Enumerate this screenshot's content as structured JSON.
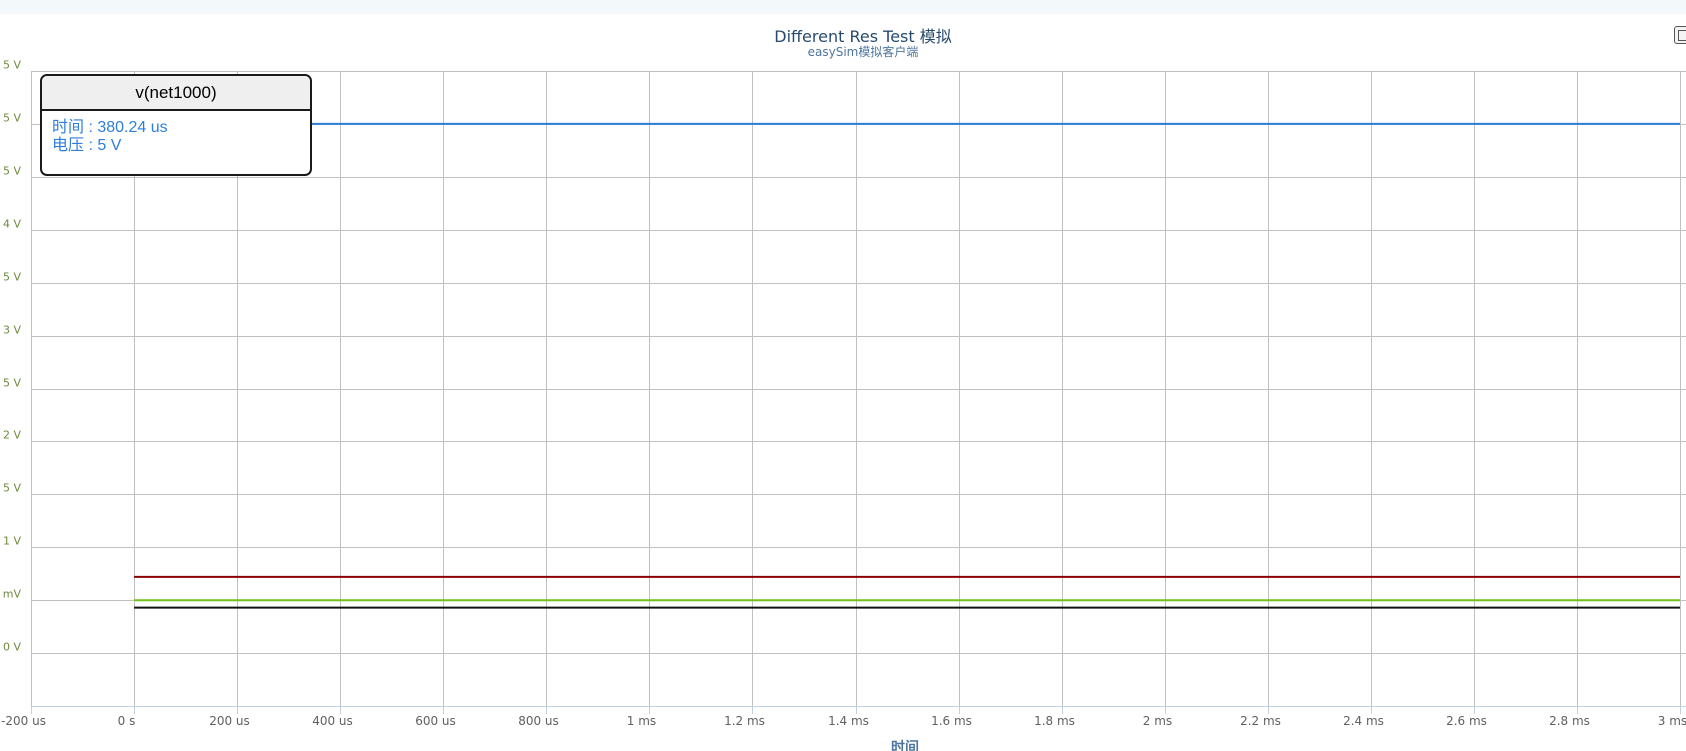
{
  "chart": {
    "title": "Different Res Test 模拟",
    "subtitle": "easySim模拟客户端",
    "xlabel": "时间"
  },
  "tooltip": {
    "series": "v(net1000)",
    "time_label": "时间",
    "time_value": "380.24 us",
    "voltage_label": "电压",
    "voltage_value": "5 V",
    "color": "#2f7ed8"
  },
  "export_button": {
    "icon": "context-menu-icon"
  },
  "chart_data": {
    "type": "line",
    "title": "Different Res Test 模拟",
    "subtitle": "easySim模拟客户端",
    "xlabel": "时间",
    "xunit": "us",
    "xlim": [
      -200,
      3000
    ],
    "ylim": [
      -0.5,
      5.5
    ],
    "grid": true,
    "x_tick_values": [
      -200,
      0,
      200,
      400,
      600,
      800,
      1000,
      1200,
      1400,
      1600,
      1800,
      2000,
      2200,
      2400,
      2600,
      2800,
      3000
    ],
    "x_tick_labels": [
      "-200 us",
      "0 s",
      "200 us",
      "400 us",
      "600 us",
      "800 us",
      "1 ms",
      "1.2 ms",
      "1.4 ms",
      "1.6 ms",
      "1.8 ms",
      "2 ms",
      "2.2 ms",
      "2.4 ms",
      "2.6 ms",
      "2.8 ms",
      "3 ms"
    ],
    "y_tick_values": [
      -0.5,
      0,
      0.5,
      1,
      1.5,
      2,
      2.5,
      3,
      3.5,
      4,
      4.5,
      5,
      5.5
    ],
    "y_tick_labels": [
      "",
      "0 V",
      "mV",
      "1 V",
      "5 V",
      "2 V",
      "5 V",
      "3 V",
      "5 V",
      "4 V",
      "5 V",
      "5 V",
      "5 V"
    ],
    "y_tick_color": "#6d8a3c",
    "series": [
      {
        "name": "v(net1000)",
        "color": "#2f7ed8",
        "x": [
          0,
          3000
        ],
        "y": [
          5,
          5
        ],
        "extends_left": true
      },
      {
        "color": "#8b0000",
        "x": [
          0,
          3000
        ],
        "y": [
          0.72,
          0.72
        ]
      },
      {
        "color": "#6fc21c",
        "x": [
          0,
          3000
        ],
        "y": [
          0.5,
          0.5
        ]
      },
      {
        "color": "#111111",
        "x": [
          0,
          3000
        ],
        "y": [
          0.43,
          0.43
        ]
      }
    ]
  }
}
